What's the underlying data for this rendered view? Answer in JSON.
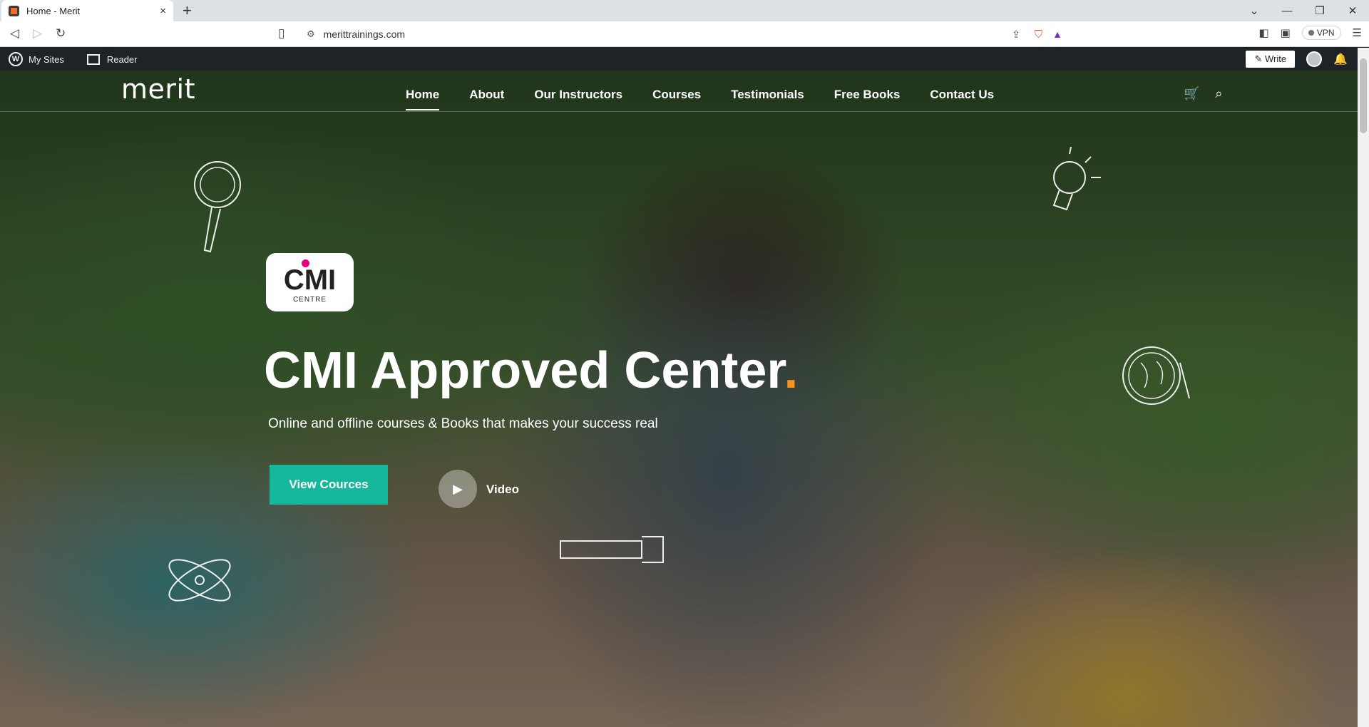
{
  "browser": {
    "tab_title": "Home - Merit",
    "new_tab": "+",
    "close": "×",
    "url": "merittrainings.com",
    "vpn": "VPN",
    "window": [
      "⌄",
      "—",
      "❐",
      "✕"
    ]
  },
  "wpbar": {
    "my_sites": "My Sites",
    "reader": "Reader",
    "write": "Write"
  },
  "site": {
    "logo": "merit",
    "menu": [
      "Home",
      "About",
      "Our Instructors",
      "Courses",
      "Testimonials",
      "Free Books",
      "Contact Us"
    ]
  },
  "hero": {
    "badge_text": "CMI",
    "badge_sub": "CENTRE",
    "title": "CMI Approved Center",
    "title_dot": ".",
    "subtitle": "Online and offline courses & Books that makes your success real",
    "cta": "View Cources",
    "video_label": "Video"
  },
  "colors": {
    "accent": "#17b79b",
    "dot": "#f7941d",
    "cmi_pink": "#e6007e"
  }
}
